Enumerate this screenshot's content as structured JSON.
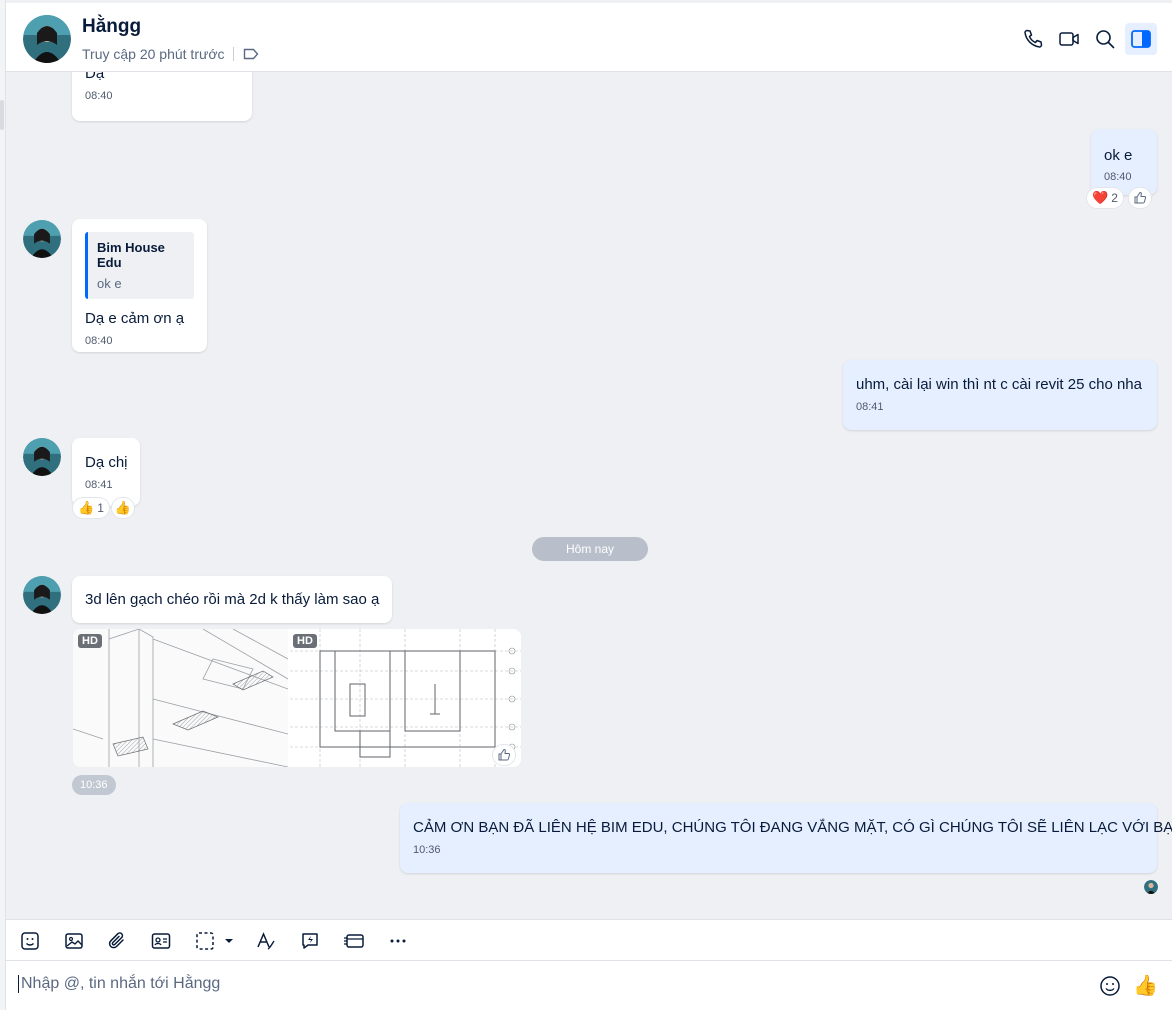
{
  "header": {
    "contact_name": "Hằngg",
    "status": "Truy cập 20 phút trước",
    "icons": [
      "phone-icon",
      "video-call-icon",
      "search-icon",
      "sidebar-toggle-icon"
    ]
  },
  "messages": [
    {
      "id": "m1",
      "direction": "in",
      "text": "Dạ",
      "time": "08:40"
    },
    {
      "id": "m2",
      "direction": "out",
      "text": "ok e",
      "time": "08:40",
      "reactions": {
        "emoji": "❤️",
        "count": "2"
      }
    },
    {
      "id": "m3",
      "direction": "in",
      "quote": {
        "author": "Bim House Edu",
        "text": "ok e"
      },
      "text": "Dạ e cảm ơn ạ",
      "time": "08:40"
    },
    {
      "id": "m4",
      "direction": "out",
      "text": "uhm, cài lại win thì nt c cài revit 25 cho nha",
      "time": "08:41"
    },
    {
      "id": "m5",
      "direction": "in",
      "text": "Dạ chị",
      "time": "08:41",
      "reactions": {
        "emoji": "👍",
        "count": "1"
      }
    },
    {
      "id": "m6",
      "direction": "in",
      "text": "3d lên gạch chéo rồi mà 2d k thấy làm sao ạ"
    },
    {
      "id": "m7",
      "direction": "in",
      "images": [
        {
          "badge": "HD"
        },
        {
          "badge": "HD"
        }
      ],
      "time": "10:36"
    },
    {
      "id": "m8",
      "direction": "out",
      "text": "CẢM ƠN BẠN ĐÃ LIÊN HỆ BIM EDU, CHÚNG TÔI ĐANG VẮNG MẶT, CÓ GÌ CHÚNG TÔI SẼ LIÊN LẠC VỚI BẠN.",
      "time": "10:36"
    }
  ],
  "date_divider": "Hôm nay",
  "toolbar": {
    "icons": [
      "sticker-icon",
      "image-icon",
      "attachment-icon",
      "contact-card-icon",
      "screenshot-icon",
      "dropdown-arrow-icon",
      "text-format-icon",
      "quick-message-icon",
      "card-icon",
      "more-icon"
    ]
  },
  "composer": {
    "placeholder": "Nhập @, tin nhắn tới Hằngg",
    "icons": [
      "emoji-icon",
      "thumbs-up-icon"
    ]
  },
  "colors": {
    "accent": "#0068ff",
    "outgoing_bubble": "#e5efff",
    "chat_bg": "#eef0f3"
  }
}
